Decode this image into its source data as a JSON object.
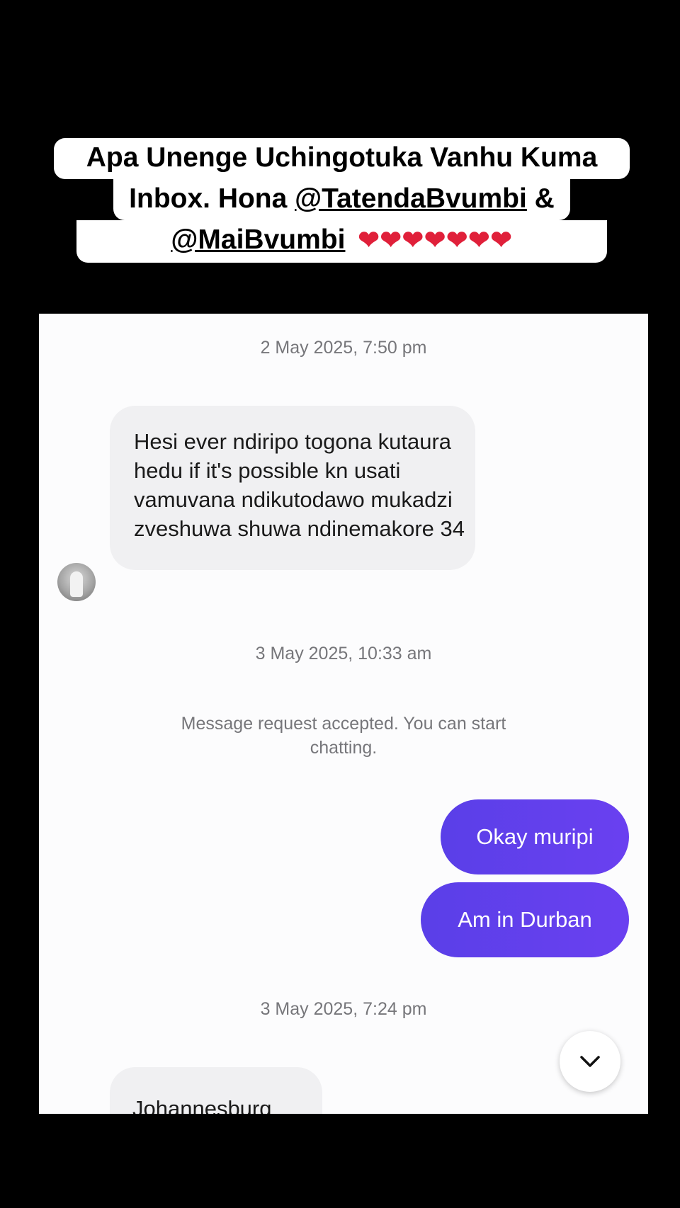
{
  "caption": {
    "line1": "Apa Unenge Uchingotuka Vanhu Kuma",
    "line2_prefix": "Inbox. Hona ",
    "line2_mention": "@TatendaBvumbi",
    "line2_suffix": " &",
    "line3_mention": "@MaiBvumbi",
    "hearts": "❤❤❤❤❤❤❤"
  },
  "chat": {
    "timestamp_1": "2 May 2025, 7:50 pm",
    "incoming_1": "Hesi ever ndiripo togona kutaura hedu if it's possible kn usati vamuvana ndikutodawo mukadzi zveshuwa shuwa ndinemakore 34",
    "timestamp_2": "3 May 2025, 10:33 am",
    "system_message": "Message request accepted. You can start chatting.",
    "outgoing_1": "Okay muripi",
    "outgoing_2": "Am in Durban",
    "timestamp_3": "3 May 2025, 7:24 pm",
    "incoming_2": "Johannesburg"
  },
  "colors": {
    "outgoing_bubble": "#5a3fe8",
    "incoming_bubble": "#f0f0f2",
    "timestamp_text": "#76767a",
    "heart": "#e0203a"
  },
  "icons": {
    "avatar": "contact-avatar",
    "scroll_down": "chevron-down-icon"
  }
}
